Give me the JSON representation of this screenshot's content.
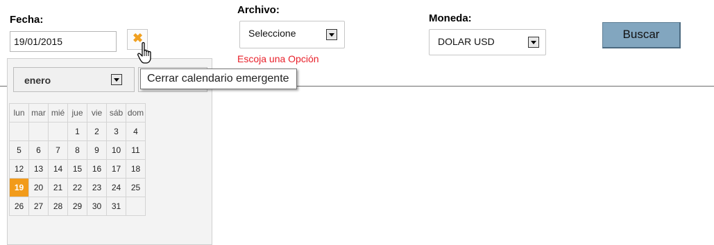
{
  "fecha": {
    "label": "Fecha:",
    "value": "19/01/2015"
  },
  "archivo": {
    "label": "Archivo:",
    "selected": "Seleccione",
    "error": "Escoja una Opción"
  },
  "moneda": {
    "label": "Moneda:",
    "selected": "DOLAR USD"
  },
  "buscar": {
    "label": "Buscar"
  },
  "tooltip": {
    "text": "Cerrar calendario emergente"
  },
  "calendar": {
    "month": "enero",
    "weekdays": [
      "lun",
      "mar",
      "mié",
      "jue",
      "vie",
      "sáb",
      "dom"
    ],
    "weeks": [
      [
        "",
        "",
        "",
        "1",
        "2",
        "3",
        "4"
      ],
      [
        "5",
        "6",
        "7",
        "8",
        "9",
        "10",
        "11"
      ],
      [
        "12",
        "13",
        "14",
        "15",
        "16",
        "17",
        "18"
      ],
      [
        "19",
        "20",
        "21",
        "22",
        "23",
        "24",
        "25"
      ],
      [
        "26",
        "27",
        "28",
        "29",
        "30",
        "31",
        ""
      ]
    ],
    "selected_day": "19"
  },
  "colors": {
    "selected_day": "#f29b1a",
    "error": "#e8202a",
    "button": "#82a6bf",
    "clear_icon": "#f0a020"
  },
  "icons": {
    "clear": "close-x-icon",
    "dropdown": "chevron-down-icon",
    "cursor": "hand-pointer-icon"
  }
}
